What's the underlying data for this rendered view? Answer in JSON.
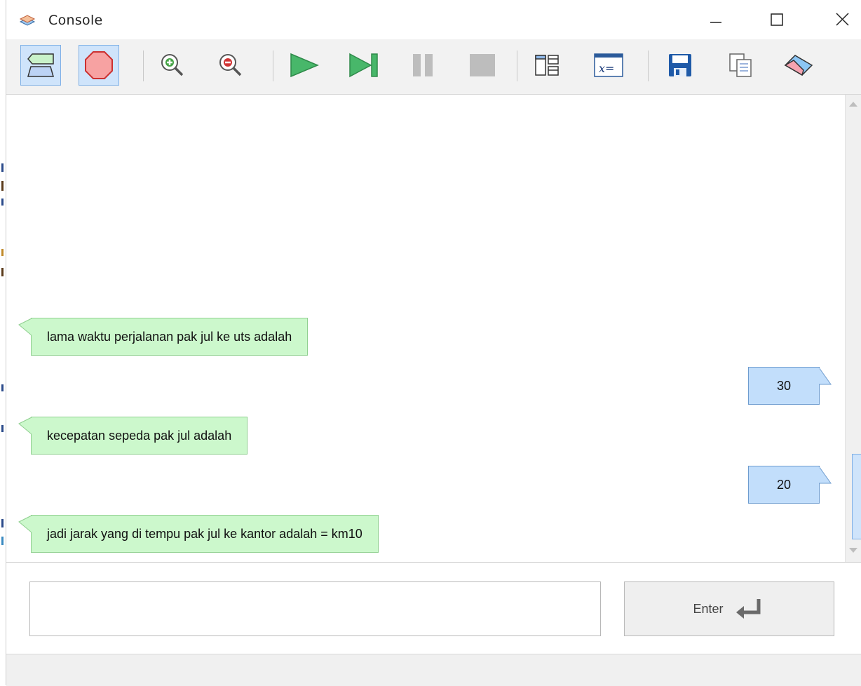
{
  "window": {
    "title": "Console",
    "app_icon": "stacked-layers-icon"
  },
  "toolbar": {
    "buttons": [
      {
        "name": "flowchart-mode-button",
        "icon": "flowchart-icon",
        "active": true
      },
      {
        "name": "stop-sign-button",
        "icon": "stop-octagon-icon",
        "active": true
      },
      {
        "name": "zoom-in-button",
        "icon": "zoom-in-icon",
        "active": false
      },
      {
        "name": "zoom-out-button",
        "icon": "zoom-out-icon",
        "active": false
      },
      {
        "name": "run-button",
        "icon": "play-icon",
        "active": false
      },
      {
        "name": "step-button",
        "icon": "step-forward-icon",
        "active": false
      },
      {
        "name": "pause-button",
        "icon": "pause-icon",
        "active": false
      },
      {
        "name": "stop-button",
        "icon": "stop-square-icon",
        "active": false
      },
      {
        "name": "layout-button",
        "icon": "layout-panels-icon",
        "active": false
      },
      {
        "name": "variables-button",
        "icon": "variable-assign-icon",
        "active": false
      },
      {
        "name": "save-button",
        "icon": "floppy-disk-icon",
        "active": false
      },
      {
        "name": "copy-button",
        "icon": "copy-pages-icon",
        "active": false
      },
      {
        "name": "clear-button",
        "icon": "eraser-icon",
        "active": false
      }
    ]
  },
  "console": {
    "messages": [
      {
        "direction": "output",
        "text": "lama waktu perjalanan pak jul ke uts adalah"
      },
      {
        "direction": "input",
        "text": "30"
      },
      {
        "direction": "output",
        "text": "kecepatan sepeda  pak jul adalah"
      },
      {
        "direction": "input",
        "text": "20"
      },
      {
        "direction": "output",
        "text": "jadi jarak yang di tempu pak jul ke kantor adalah = km10"
      }
    ]
  },
  "input": {
    "value": "",
    "placeholder": "",
    "enter_label": "Enter"
  },
  "colors": {
    "output_bubble": "#ccf8cc",
    "input_bubble": "#c2defb",
    "toolbar_active": "#cfe4fb"
  }
}
